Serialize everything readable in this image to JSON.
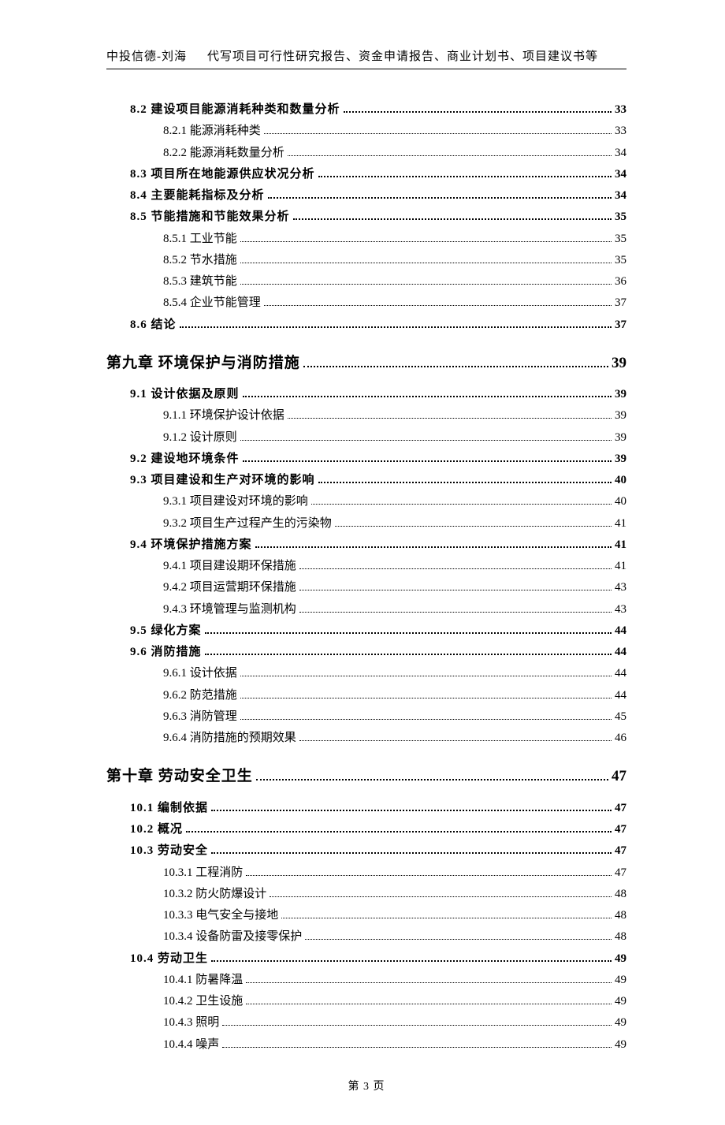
{
  "header": {
    "left": "中投信德-刘海",
    "right": "代写项目可行性研究报告、资金申请报告、商业计划书、项目建议书等"
  },
  "toc": [
    {
      "level": 2,
      "label": "8.2 建设项目能源消耗种类和数量分析",
      "page": "33"
    },
    {
      "level": 3,
      "label": "8.2.1 能源消耗种类",
      "page": "33"
    },
    {
      "level": 3,
      "label": "8.2.2 能源消耗数量分析",
      "page": "34"
    },
    {
      "level": 2,
      "label": "8.3 项目所在地能源供应状况分析",
      "page": "34"
    },
    {
      "level": 2,
      "label": "8.4 主要能耗指标及分析",
      "page": "34"
    },
    {
      "level": 2,
      "label": "8.5 节能措施和节能效果分析",
      "page": "35"
    },
    {
      "level": 3,
      "label": "8.5.1 工业节能",
      "page": "35"
    },
    {
      "level": 3,
      "label": "8.5.2 节水措施",
      "page": "35"
    },
    {
      "level": 3,
      "label": "8.5.3 建筑节能",
      "page": "36"
    },
    {
      "level": 3,
      "label": "8.5.4 企业节能管理",
      "page": "37"
    },
    {
      "level": 2,
      "label": "8.6 结论",
      "page": "37"
    },
    {
      "level": 1,
      "label": "第九章  环境保护与消防措施",
      "page": "39"
    },
    {
      "level": 2,
      "label": "9.1 设计依据及原则",
      "page": "39"
    },
    {
      "level": 3,
      "label": "9.1.1 环境保护设计依据",
      "page": "39"
    },
    {
      "level": 3,
      "label": "9.1.2 设计原则",
      "page": "39"
    },
    {
      "level": 2,
      "label": "9.2 建设地环境条件",
      "page": "39"
    },
    {
      "level": 2,
      "label": "9.3  项目建设和生产对环境的影响",
      "page": "40"
    },
    {
      "level": 3,
      "label": "9.3.1  项目建设对环境的影响",
      "page": "40"
    },
    {
      "level": 3,
      "label": "9.3.2  项目生产过程产生的污染物",
      "page": "41"
    },
    {
      "level": 2,
      "label": "9.4  环境保护措施方案",
      "page": "41"
    },
    {
      "level": 3,
      "label": "9.4.1  项目建设期环保措施",
      "page": "41"
    },
    {
      "level": 3,
      "label": "9.4.2  项目运营期环保措施",
      "page": "43"
    },
    {
      "level": 3,
      "label": "9.4.3  环境管理与监测机构",
      "page": "43"
    },
    {
      "level": 2,
      "label": "9.5 绿化方案",
      "page": "44"
    },
    {
      "level": 2,
      "label": "9.6 消防措施",
      "page": "44"
    },
    {
      "level": 3,
      "label": "9.6.1 设计依据",
      "page": "44"
    },
    {
      "level": 3,
      "label": "9.6.2 防范措施",
      "page": "44"
    },
    {
      "level": 3,
      "label": "9.6.3 消防管理",
      "page": "45"
    },
    {
      "level": 3,
      "label": "9.6.4 消防措施的预期效果",
      "page": "46"
    },
    {
      "level": 1,
      "label": "第十章  劳动安全卫生",
      "page": "47"
    },
    {
      "level": 2,
      "label": "10.1  编制依据",
      "page": "47"
    },
    {
      "level": 2,
      "label": "10.2 概况",
      "page": "47"
    },
    {
      "level": 2,
      "label": "10.3  劳动安全",
      "page": "47"
    },
    {
      "level": 3,
      "label": "10.3.1 工程消防",
      "page": "47"
    },
    {
      "level": 3,
      "label": "10.3.2 防火防爆设计",
      "page": "48"
    },
    {
      "level": 3,
      "label": "10.3.3 电气安全与接地",
      "page": "48"
    },
    {
      "level": 3,
      "label": "10.3.4 设备防雷及接零保护",
      "page": "48"
    },
    {
      "level": 2,
      "label": "10.4 劳动卫生",
      "page": "49"
    },
    {
      "level": 3,
      "label": "10.4.1 防暑降温",
      "page": "49"
    },
    {
      "level": 3,
      "label": "10.4.2 卫生设施",
      "page": "49"
    },
    {
      "level": 3,
      "label": "10.4.3 照明",
      "page": "49"
    },
    {
      "level": 3,
      "label": "10.4.4 噪声",
      "page": "49"
    }
  ],
  "footer": "第 3 页"
}
